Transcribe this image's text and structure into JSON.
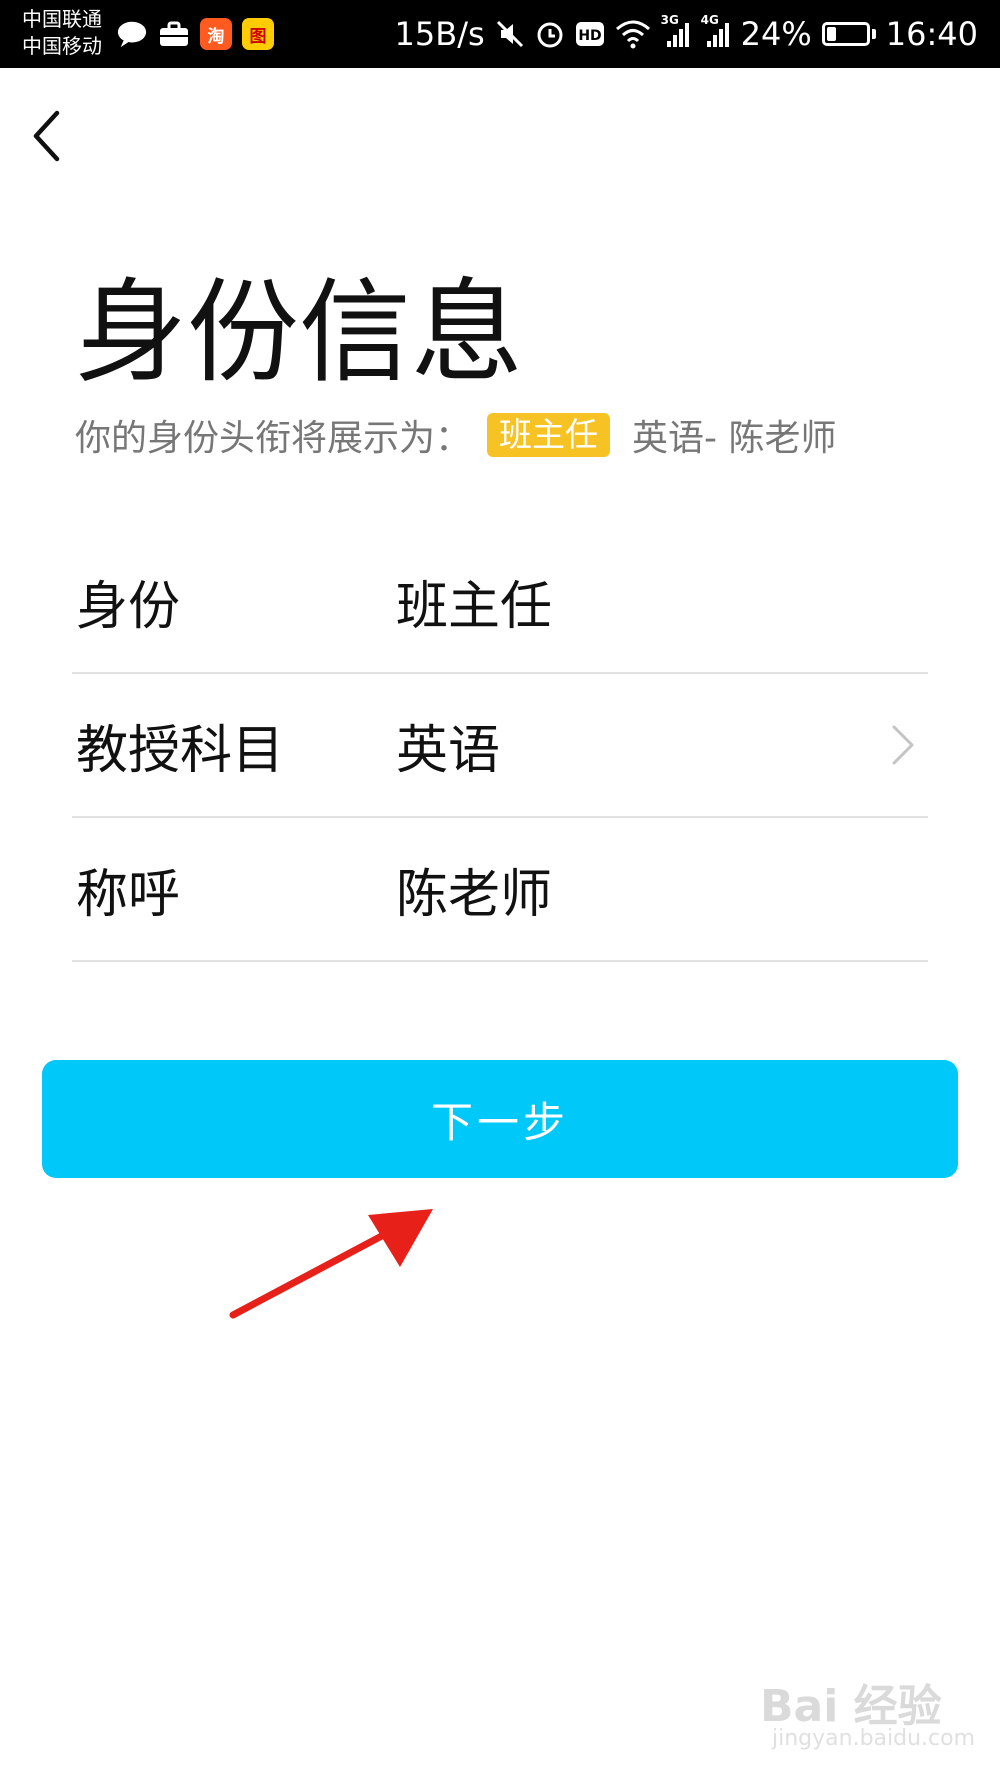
{
  "status_bar": {
    "carrier_1": "中国联通",
    "carrier_2": "中国移动",
    "apps": [
      {
        "name": "message-icon"
      },
      {
        "name": "briefcase-icon"
      },
      {
        "name": "taobao-app-icon",
        "label": "淘"
      },
      {
        "name": "app-icon",
        "label": "图"
      }
    ],
    "net_speed": "15B/s",
    "network_3g": "3G",
    "network_4g": "4G",
    "battery_percent": "24%",
    "battery_level": 0.24,
    "time": "16:40"
  },
  "page": {
    "title": "身份信息",
    "subtitle_prefix": "你的身份头衔将展示为：",
    "role_badge": "班主任",
    "subtitle_suffix": "英语- 陈老师"
  },
  "form": {
    "rows": [
      {
        "label": "身份",
        "value": "班主任",
        "has_chevron": false
      },
      {
        "label": "教授科目",
        "value": "英语",
        "has_chevron": true
      },
      {
        "label": "称呼",
        "value": "陈老师",
        "has_chevron": false
      }
    ]
  },
  "actions": {
    "next_label": "下一步"
  },
  "watermark": {
    "brand": "Bai 经验",
    "url": "jingyan.baidu.com"
  },
  "colors": {
    "primary_button": "#00c8f8",
    "role_badge": "#f6c224",
    "annotation_arrow": "#e8201a"
  }
}
